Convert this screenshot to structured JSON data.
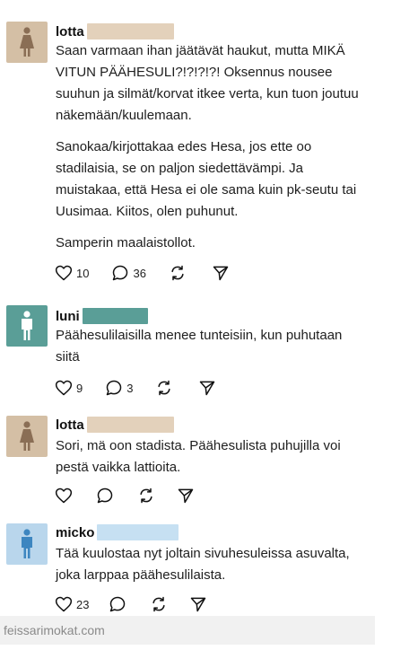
{
  "posts": [
    {
      "username": "lotta",
      "paragraphs": [
        "Saan varmaan ihan jäätävät haukut, mutta MIKÄ VITUN PÄÄHESULI?!?!?!?! Oksennus nousee suuhun ja silmät/korvat itkee verta, kun tuon joutuu näkemään/kuulemaan.",
        "Sanokaa/kirjottakaa edes Hesa, jos ette oo stadilaisia, se on paljon siedettävämpi. Ja muistakaa, että Hesa ei ole sama kuin pk-seutu tai Uusimaa. Kiitos, olen puhunut.",
        "Samperin maalaistollot."
      ],
      "likes": "10",
      "comments": "36"
    },
    {
      "username": "luni",
      "paragraphs": [
        "Päähesulilaisilla menee tunteisiin, kun puhutaan siitä"
      ],
      "likes": "9",
      "comments": "3"
    },
    {
      "username": "lotta",
      "paragraphs": [
        "Sori, mä oon stadista. Päähesulista puhujilla voi pestä vaikka lattioita."
      ],
      "likes": "",
      "comments": ""
    },
    {
      "username": "micko",
      "paragraphs": [
        "Tää kuulostaa nyt joltain sivuhesuleissa asuvalta, joka larppaa päähesulilaista."
      ],
      "likes": "23",
      "comments": ""
    }
  ],
  "icons": {
    "avatar": "person-silhouette-icon",
    "like": "heart-icon",
    "comment": "comment-bubble-icon",
    "repost": "repost-icon",
    "share": "send-icon"
  },
  "colors": {
    "avatar_female": "#d4bfa5",
    "avatar_male_teal": "#5a9e97",
    "avatar_male_blue": "#b9d6ec",
    "figure_female": "#8a6e55",
    "figure_male_teal": "#ffffff",
    "figure_male_blue": "#3d86c0"
  },
  "watermark": "feissarimokat.com"
}
